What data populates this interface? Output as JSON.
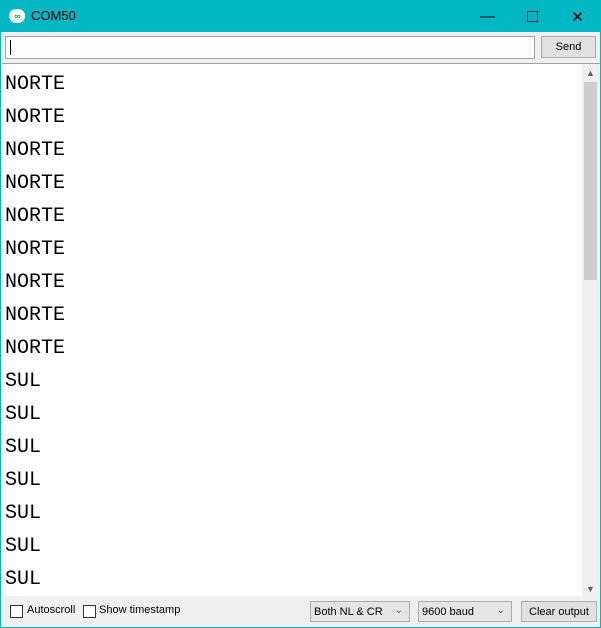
{
  "window": {
    "title": "COM50",
    "accent": "#00b7c3"
  },
  "send_row": {
    "input_value": "",
    "send_label": "Send"
  },
  "output": {
    "lines": [
      "NORTE",
      "NORTE",
      "NORTE",
      "NORTE",
      "NORTE",
      "NORTE",
      "NORTE",
      "NORTE",
      "NORTE",
      "SUL",
      "SUL",
      "SUL",
      "SUL",
      "SUL",
      "SUL",
      "SUL"
    ]
  },
  "footer": {
    "autoscroll_label": "Autoscroll",
    "autoscroll_checked": false,
    "timestamp_label": "Show timestamp",
    "timestamp_checked": false,
    "line_ending": "Both NL & CR",
    "baud": "9600 baud",
    "clear_label": "Clear output"
  }
}
